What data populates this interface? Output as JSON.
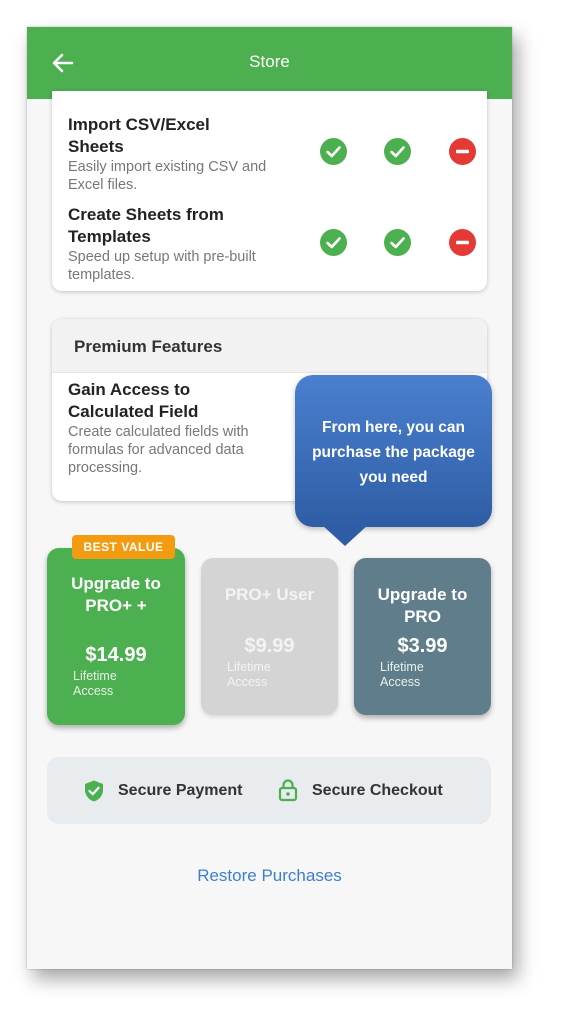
{
  "header": {
    "title": "Store"
  },
  "features": [
    {
      "title": "Import CSV/Excel Sheets",
      "description": "Easily import existing CSV and Excel files.",
      "status": [
        "check-icon",
        "check-icon",
        "minus-icon"
      ]
    },
    {
      "title": "Create Sheets from Templates",
      "description": "Speed up setup with pre-built templates.",
      "status": [
        "check-icon",
        "check-icon",
        "minus-icon"
      ]
    }
  ],
  "premium": {
    "header": "Premium Features",
    "feature_title": "Gain Access to Calculated Field",
    "feature_description": "Create calculated fields with formulas for advanced data processing."
  },
  "tooltip": {
    "text": "From here, you can purchase the package you need"
  },
  "plans": [
    {
      "badge": "BEST VALUE",
      "name": "Upgrade to PRO+ +",
      "price": "$14.99",
      "note": "Lifetime Access"
    },
    {
      "name": "PRO+ User",
      "price": "$9.99",
      "note": "Lifetime Access"
    },
    {
      "name": "Upgrade to PRO",
      "price": "$3.99",
      "note": "Lifetime Access"
    }
  ],
  "secure": {
    "payment": "Secure Payment",
    "checkout": "Secure Checkout"
  },
  "footer": {
    "restore": "Restore Purchases"
  },
  "colors": {
    "primary": "#4caf50",
    "check": "#4caf50",
    "minus": "#e53935",
    "badge": "#f39c12",
    "pro": "#607d8b",
    "link": "#3b7fd0",
    "tooltip": "#3a6cb8"
  }
}
